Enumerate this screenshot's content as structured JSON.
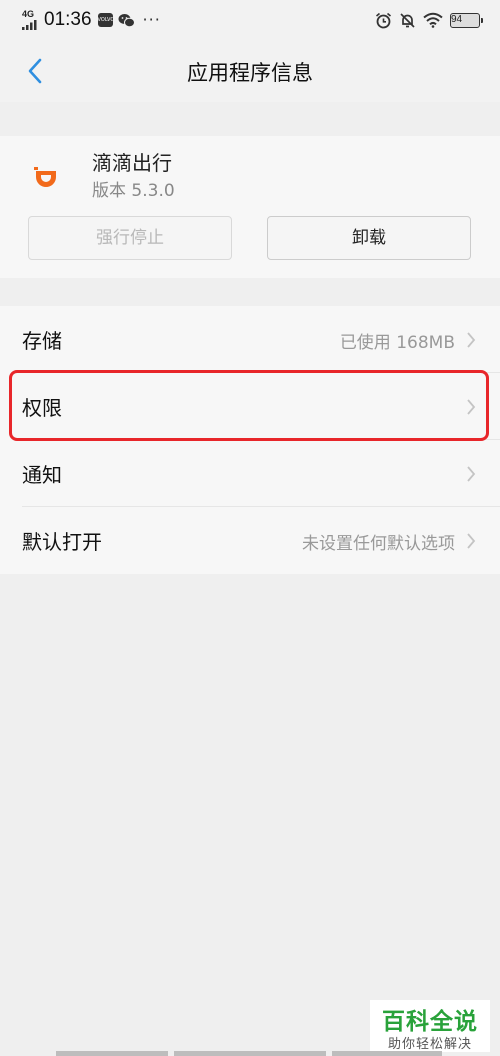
{
  "status_bar": {
    "network": "4G",
    "time": "01:36",
    "notification_badge": "VOLVO",
    "more": "···",
    "battery": "94",
    "icons": [
      "signal-icon",
      "notification-app-icon",
      "wechat-icon",
      "alarm-icon",
      "bell-muted-icon",
      "wifi-icon",
      "battery-icon"
    ]
  },
  "header": {
    "title": "应用程序信息",
    "back_icon": "chevron-left-icon"
  },
  "app": {
    "name": "滴滴出行",
    "version": "版本 5.3.0",
    "icon": "didi-logo-icon",
    "icon_color": "#f26a1b",
    "force_stop_label": "强行停止",
    "uninstall_label": "卸载"
  },
  "settings": {
    "items": [
      {
        "label": "存储",
        "value": "已使用 168MB"
      },
      {
        "label": "权限",
        "value": ""
      },
      {
        "label": "通知",
        "value": ""
      },
      {
        "label": "默认打开",
        "value": "未设置任何默认选项"
      }
    ],
    "highlight_color": "#e8262a"
  },
  "watermark": {
    "main": "百科全说",
    "sub": "助你轻松解决",
    "color": "#29a23a"
  },
  "colors": {
    "accent": "#2f8fe0",
    "background": "#efefef"
  }
}
